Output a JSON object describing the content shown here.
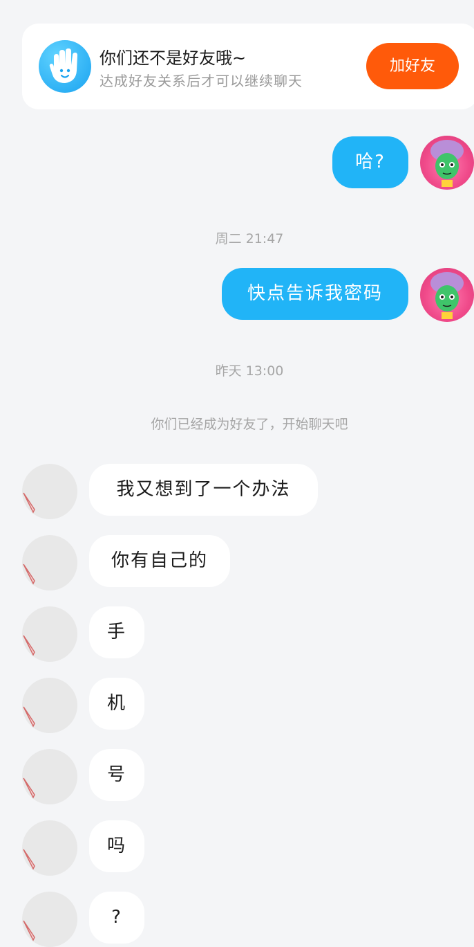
{
  "banner": {
    "title": "你们还不是好友哦~",
    "subtitle": "达成好友关系后才可以继续聊天",
    "add_button": "加好友"
  },
  "messages_out": [
    {
      "text": "哈?"
    },
    {
      "text": "快点告诉我密码"
    }
  ],
  "timestamps": [
    "周二 21:47",
    "昨天 13:00"
  ],
  "system_message": "你们已经成为好友了，开始聊天吧",
  "messages_in": [
    {
      "text": "我又想到了一个办法"
    },
    {
      "text": "你有自己的"
    },
    {
      "text": "手"
    },
    {
      "text": "机"
    },
    {
      "text": "号"
    },
    {
      "text": "吗"
    },
    {
      "text": "?"
    }
  ],
  "colors": {
    "background": "#f4f5f7",
    "out_bubble": "#21b4f7",
    "add_button": "#ff5a0a",
    "banner_icon": "#1aa3f0"
  }
}
